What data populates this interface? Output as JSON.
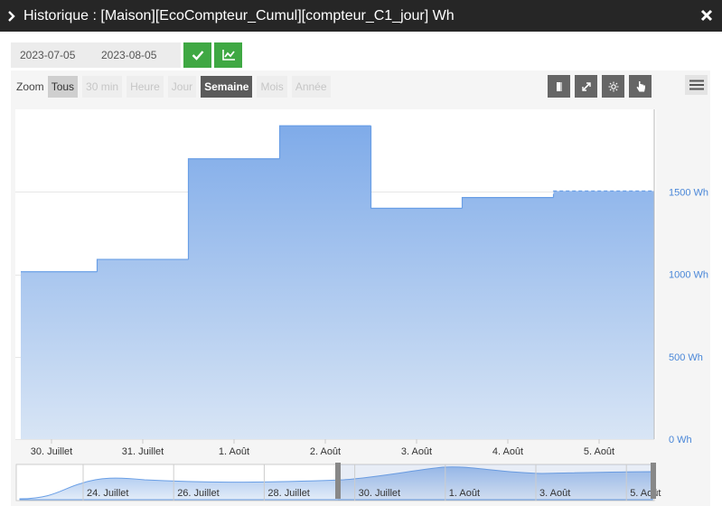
{
  "window": {
    "title": "Historique : [Maison][EcoCompteur_Cumul][compteur_C1_jour] Wh"
  },
  "date_range": {
    "start": "2023-07-05",
    "end": "2023-08-05"
  },
  "zoom": {
    "label": "Zoom",
    "buttons": [
      {
        "label": "Tous",
        "state": "active"
      },
      {
        "label": "30 min",
        "state": "disabled"
      },
      {
        "label": "Heure",
        "state": "disabled"
      },
      {
        "label": "Jour",
        "state": "disabled"
      },
      {
        "label": "Semaine",
        "state": "selected"
      },
      {
        "label": "Mois",
        "state": "disabled"
      },
      {
        "label": "Année",
        "state": "disabled"
      }
    ]
  },
  "colors": {
    "title_bg": "#262626",
    "accent_green": "#3fa843",
    "series_line": "#6a9fe6",
    "series_fill_top": "#7fabe9",
    "series_fill_bottom": "#d8e5f5",
    "axis_label": "#4a87d8"
  },
  "chart_data": {
    "type": "area",
    "step": true,
    "x": [
      "29. Juillet 12h",
      "30. Juillet 12h",
      "31. Juillet 12h",
      "1. Août 12h",
      "2. Août 12h",
      "3. Août 12h",
      "4. Août 12h",
      "5. Août 12h"
    ],
    "x_ticks": [
      "30. Juillet",
      "31. Juillet",
      "1. Août",
      "2. Août",
      "3. Août",
      "4. Août",
      "5. Août"
    ],
    "y_ticks": [
      "0 Wh",
      "500 Wh",
      "1000 Wh",
      "1500 Wh"
    ],
    "ylim": [
      0,
      2000
    ],
    "series": [
      {
        "values": [
          1015,
          1090,
          1700,
          1900,
          1400,
          1465,
          1505
        ]
      }
    ],
    "last_segment_dashed": true,
    "grid": true,
    "navigator": {
      "ticks": [
        "24. Juillet",
        "26. Juillet",
        "28. Juillet",
        "30. Juillet",
        "1. Août",
        "3. Août",
        "5. Août"
      ]
    }
  }
}
